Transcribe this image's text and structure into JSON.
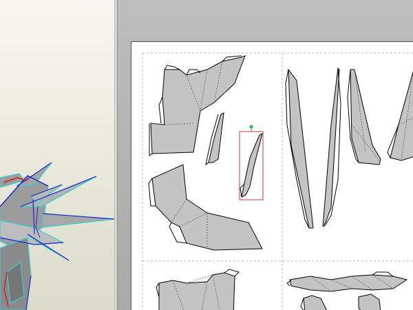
{
  "app": {
    "views": [
      "3d-model-view",
      "2d-development-view"
    ]
  },
  "colors": {
    "part_fill": "#c4c4c4",
    "part_outline": "#000000",
    "fold_line": "#555555",
    "page_guide": "#b5b5b5",
    "selection_box": "#e03030",
    "rotate_handle": "#2bb33c",
    "model_edge_cyan": "#31d3d3",
    "model_edge_blue": "#2222cc",
    "model_edge_red": "#d02020",
    "model_face": "#8f8f8f"
  },
  "sheet": {
    "piece_count_visible": 12,
    "selected_piece": "sliver-piece-selected"
  }
}
